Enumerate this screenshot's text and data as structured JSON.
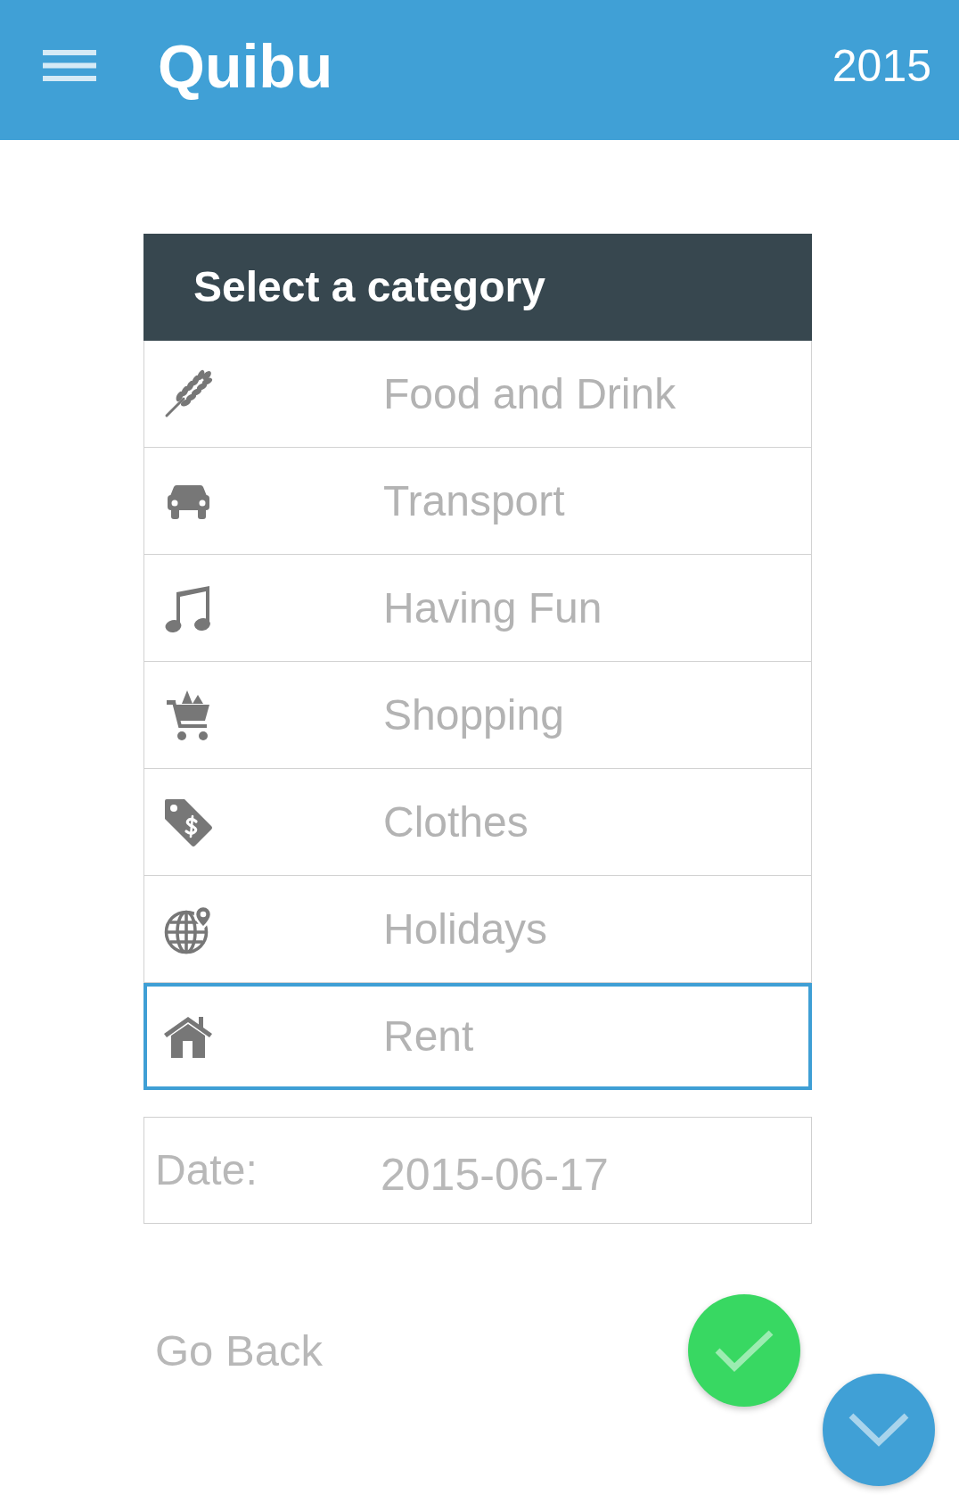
{
  "app_bar": {
    "title": "Quibu",
    "year": "2015"
  },
  "category_picker": {
    "title": "Select a category",
    "categories": [
      {
        "label": "Food and Drink",
        "kind": "food",
        "selected": false
      },
      {
        "label": "Transport",
        "kind": "transport",
        "selected": false
      },
      {
        "label": "Having Fun",
        "kind": "fun",
        "selected": false
      },
      {
        "label": "Shopping",
        "kind": "shopping",
        "selected": false
      },
      {
        "label": "Clothes",
        "kind": "clothes",
        "selected": false
      },
      {
        "label": "Holidays",
        "kind": "holidays",
        "selected": false
      },
      {
        "label": "Rent",
        "kind": "rent",
        "selected": true
      }
    ]
  },
  "date_field": {
    "label": "Date:",
    "value": "2015-06-17"
  },
  "actions": {
    "go_back": "Go Back"
  }
}
